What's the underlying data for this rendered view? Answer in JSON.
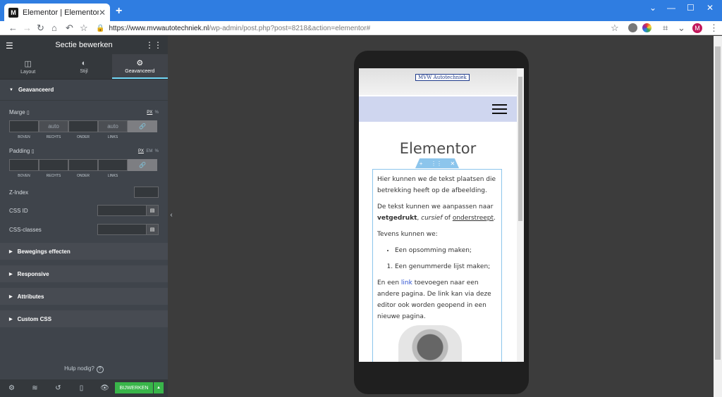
{
  "browser": {
    "tab_title": "Elementor | Elementor",
    "favicon_letter": "M",
    "url_host": "https://www.mvwautotechniek.nl",
    "url_path": "/wp-admin/post.php?post=8218&action=elementor#",
    "avatar_letter": "M"
  },
  "panel": {
    "header_title": "Sectie bewerken",
    "tabs": [
      {
        "label": "Layout",
        "icon": "layout-icon"
      },
      {
        "label": "Stijl",
        "icon": "contrast-icon"
      },
      {
        "label": "Geavanceerd",
        "icon": "gear-icon",
        "active": true
      }
    ],
    "section_title": "Geavanceerd",
    "marge": {
      "label": "Marge",
      "units": [
        "PX",
        "%"
      ],
      "values": [
        "",
        "auto",
        "",
        "auto"
      ],
      "labels": [
        "BOVEN",
        "RECHTS",
        "ONDER",
        "LINKS"
      ]
    },
    "padding": {
      "label": "Padding",
      "units": [
        "PX",
        "EM",
        "%"
      ],
      "values": [
        "",
        "",
        "",
        ""
      ],
      "labels": [
        "BOVEN",
        "RECHTS",
        "ONDER",
        "LINKS"
      ]
    },
    "zindex_label": "Z-Index",
    "cssid_label": "CSS ID",
    "cssclasses_label": "CSS-classes",
    "collapsed_sections": [
      "Bewegings effecten",
      "Responsive",
      "Attributes",
      "Custom CSS"
    ],
    "help_text": "Hulp nodig?",
    "publish_label": "BIJWERKEN"
  },
  "preview": {
    "logo_text": "MVW Autotechniek",
    "heading": "Elementor",
    "p1": "Hier kunnen we de tekst plaatsen die betrekking heeft op de afbeelding.",
    "p2_start": "De tekst kunnen we aanpassen naar",
    "p2_bold": "vetgedrukt",
    "p2_italic": "cursief",
    "p2_of": "of",
    "p2_under": "onderstreept",
    "p3": "Tevens kunnen we:",
    "ul_item": "Een opsomming maken;",
    "ol_item": "Een genummerde lijst maken;",
    "p4_start": "En een",
    "p4_link": "link",
    "p4_rest": "toevoegen naar een andere pagina. De link kan via deze editor ook worden geopend in een nieuwe pagina."
  }
}
